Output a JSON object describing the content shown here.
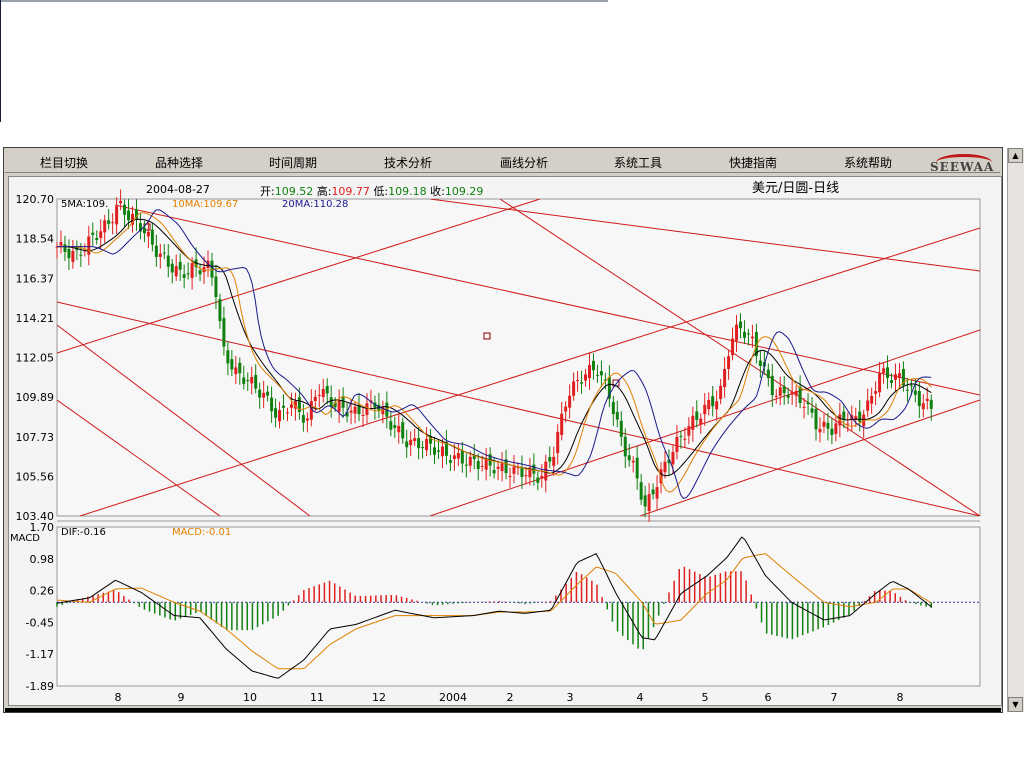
{
  "menu": {
    "items": [
      "栏目切换",
      "品种选择",
      "时间周期",
      "技术分析",
      "画线分析",
      "系统工具",
      "快捷指南",
      "系统帮助"
    ],
    "logo": "SEEWAA"
  },
  "header": {
    "date": "2004-08-27",
    "open_label": "开:",
    "open": "109.52",
    "high_label": "高:",
    "high": "109.77",
    "low_label": "低:",
    "low": "109.18",
    "close_label": "收:",
    "close": "109.29",
    "title": "美元/日圆-日线"
  },
  "ma_legend": {
    "ma5": "5MA:109.",
    "ma10": "10MA:109.67",
    "ma20": "20MA:110.28"
  },
  "macd_legend": {
    "panel_label": "MACD",
    "dif": "DIF:-0.16",
    "macd": "MACD:-0.01"
  },
  "colors": {
    "up": "#e02020",
    "down": "#108010",
    "ma5": "#000000",
    "ma10": "#e08000",
    "ma20": "#1a1a8c",
    "trend": "#d01818",
    "zero_line": "#3030a0"
  },
  "chart_data": [
    {
      "type": "candlestick",
      "title": "美元/日圆-日线",
      "y_ticks": [
        "120.70",
        "118.54",
        "116.37",
        "114.21",
        "112.05",
        "109.89",
        "107.73",
        "105.56",
        "103.40"
      ],
      "ylim": [
        103.4,
        120.7
      ],
      "x_ticks": [
        "8",
        "9",
        "10",
        "11",
        "12",
        "2004",
        "2",
        "3",
        "4",
        "5",
        "6",
        "7",
        "8"
      ],
      "x_range": [
        0,
        13.5
      ],
      "grid": false,
      "close_path": [
        [
          0.0,
          118.1
        ],
        [
          0.3,
          117.6
        ],
        [
          0.55,
          118.6
        ],
        [
          0.8,
          119.4
        ],
        [
          0.95,
          120.4
        ],
        [
          1.1,
          119.8
        ],
        [
          1.3,
          119.2
        ],
        [
          1.5,
          118.0
        ],
        [
          1.7,
          117.2
        ],
        [
          1.9,
          116.6
        ],
        [
          2.1,
          116.9
        ],
        [
          2.35,
          117.0
        ],
        [
          2.45,
          115.6
        ],
        [
          2.55,
          112.5
        ],
        [
          2.75,
          111.2
        ],
        [
          2.95,
          110.8
        ],
        [
          3.2,
          109.9
        ],
        [
          3.4,
          108.8
        ],
        [
          3.6,
          109.6
        ],
        [
          3.85,
          108.6
        ],
        [
          4.0,
          110.4
        ],
        [
          4.3,
          109.4
        ],
        [
          4.6,
          109.0
        ],
        [
          4.9,
          109.6
        ],
        [
          5.1,
          108.6
        ],
        [
          5.4,
          107.4
        ],
        [
          5.7,
          107.3
        ],
        [
          6.0,
          106.7
        ],
        [
          6.3,
          106.4
        ],
        [
          6.6,
          106.2
        ],
        [
          6.9,
          105.9
        ],
        [
          7.2,
          105.8
        ],
        [
          7.45,
          105.5
        ],
        [
          7.65,
          107.0
        ],
        [
          7.85,
          110.0
        ],
        [
          8.1,
          111.1
        ],
        [
          8.3,
          111.5
        ],
        [
          8.5,
          110.0
        ],
        [
          8.7,
          107.3
        ],
        [
          8.9,
          105.8
        ],
        [
          9.05,
          103.8
        ],
        [
          9.25,
          105.4
        ],
        [
          9.5,
          107.2
        ],
        [
          9.75,
          108.4
        ],
        [
          10.0,
          109.4
        ],
        [
          10.2,
          110.0
        ],
        [
          10.35,
          112.8
        ],
        [
          10.5,
          113.8
        ],
        [
          10.7,
          112.9
        ],
        [
          10.9,
          111.1
        ],
        [
          11.05,
          110.0
        ],
        [
          11.25,
          110.2
        ],
        [
          11.5,
          109.6
        ],
        [
          11.7,
          108.3
        ],
        [
          11.9,
          108.1
        ],
        [
          12.1,
          108.8
        ],
        [
          12.3,
          108.6
        ],
        [
          12.5,
          109.5
        ],
        [
          12.65,
          111.2
        ],
        [
          12.8,
          111.0
        ],
        [
          13.0,
          110.9
        ],
        [
          13.2,
          109.9
        ],
        [
          13.45,
          109.3
        ]
      ],
      "ma_series": [
        {
          "name": "5MA",
          "shift": 0.12,
          "weight": 0.85
        },
        {
          "name": "10MA",
          "shift": 0.28,
          "weight": 0.7
        },
        {
          "name": "20MA",
          "shift": 0.55,
          "weight": 0.55
        }
      ]
    },
    {
      "type": "macd",
      "y_ticks": [
        "1.70",
        "0.98",
        "0.26",
        "-0.45",
        "-1.17",
        "-1.89"
      ],
      "ylim": [
        -1.89,
        1.7
      ],
      "dif_path": [
        [
          0.0,
          -0.02
        ],
        [
          0.5,
          0.1
        ],
        [
          0.9,
          0.5
        ],
        [
          1.3,
          0.22
        ],
        [
          1.8,
          -0.3
        ],
        [
          2.2,
          -0.35
        ],
        [
          2.6,
          -1.05
        ],
        [
          3.0,
          -1.55
        ],
        [
          3.4,
          -1.72
        ],
        [
          3.8,
          -1.3
        ],
        [
          4.2,
          -0.6
        ],
        [
          4.6,
          -0.5
        ],
        [
          5.2,
          -0.18
        ],
        [
          5.8,
          -0.35
        ],
        [
          6.4,
          -0.3
        ],
        [
          6.8,
          -0.2
        ],
        [
          7.2,
          -0.25
        ],
        [
          7.6,
          -0.18
        ],
        [
          8.0,
          0.9
        ],
        [
          8.3,
          1.1
        ],
        [
          8.6,
          0.2
        ],
        [
          9.0,
          -0.8
        ],
        [
          9.2,
          -0.85
        ],
        [
          9.6,
          0.2
        ],
        [
          10.0,
          0.6
        ],
        [
          10.3,
          1.0
        ],
        [
          10.55,
          1.5
        ],
        [
          10.9,
          0.6
        ],
        [
          11.3,
          0.0
        ],
        [
          11.8,
          -0.4
        ],
        [
          12.2,
          -0.3
        ],
        [
          12.6,
          0.2
        ],
        [
          12.85,
          0.48
        ],
        [
          13.1,
          0.3
        ],
        [
          13.45,
          -0.1
        ]
      ],
      "macd_path": [
        [
          0.0,
          0.05
        ],
        [
          0.5,
          0.0
        ],
        [
          0.9,
          0.3
        ],
        [
          1.3,
          0.32
        ],
        [
          1.8,
          0.0
        ],
        [
          2.2,
          -0.2
        ],
        [
          2.6,
          -0.6
        ],
        [
          3.0,
          -1.1
        ],
        [
          3.4,
          -1.5
        ],
        [
          3.8,
          -1.5
        ],
        [
          4.2,
          -0.95
        ],
        [
          4.6,
          -0.6
        ],
        [
          5.2,
          -0.3
        ],
        [
          5.8,
          -0.3
        ],
        [
          6.4,
          -0.3
        ],
        [
          6.8,
          -0.22
        ],
        [
          7.2,
          -0.22
        ],
        [
          7.6,
          -0.2
        ],
        [
          8.0,
          0.4
        ],
        [
          8.3,
          0.8
        ],
        [
          8.6,
          0.65
        ],
        [
          9.0,
          0.0
        ],
        [
          9.2,
          -0.5
        ],
        [
          9.6,
          -0.4
        ],
        [
          10.0,
          0.2
        ],
        [
          10.3,
          0.5
        ],
        [
          10.55,
          1.0
        ],
        [
          10.9,
          1.1
        ],
        [
          11.3,
          0.6
        ],
        [
          11.8,
          0.0
        ],
        [
          12.2,
          -0.1
        ],
        [
          12.6,
          0.0
        ],
        [
          12.85,
          0.3
        ],
        [
          13.1,
          0.3
        ],
        [
          13.45,
          -0.01
        ]
      ]
    }
  ]
}
